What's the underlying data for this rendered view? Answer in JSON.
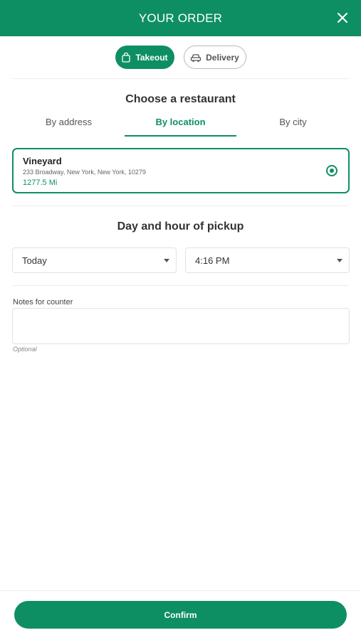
{
  "header": {
    "title": "YOUR ORDER",
    "close_icon": "close-icon"
  },
  "order_mode": {
    "selected": "Takeout",
    "options": [
      {
        "label": "Takeout",
        "icon": "shopping-bag-icon"
      },
      {
        "label": "Delivery",
        "icon": "car-icon"
      }
    ]
  },
  "restaurant_section": {
    "title": "Choose a restaurant",
    "tabs": [
      {
        "label": "By address"
      },
      {
        "label": "By location"
      },
      {
        "label": "By city"
      }
    ],
    "active_tab": "By location",
    "selected_restaurant": {
      "name": "Vineyard",
      "address": "233 Broadway, New York, New York, 10279",
      "distance": "1277.5 Mi",
      "selected": true
    }
  },
  "pickup_section": {
    "title": "Day and hour of pickup",
    "day_value": "Today",
    "time_value": "4:16 PM"
  },
  "notes": {
    "label": "Notes for counter",
    "value": "",
    "hint": "Optional"
  },
  "footer": {
    "confirm_label": "Confirm"
  },
  "colors": {
    "accent": "#0e8f63",
    "text": "#333333",
    "border": "#e2e2e2"
  }
}
